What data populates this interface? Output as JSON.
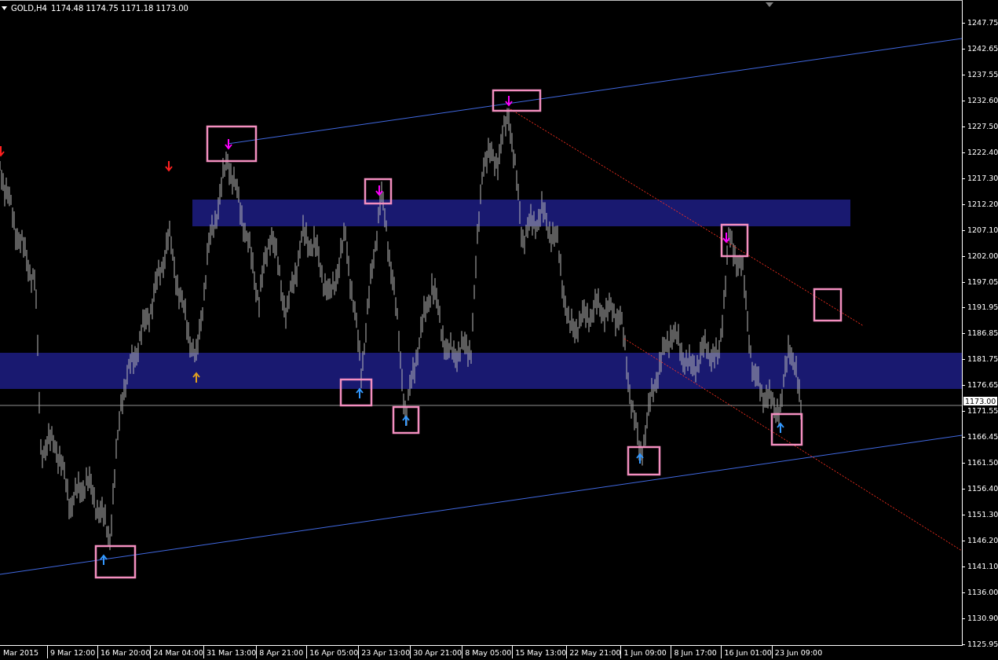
{
  "header": {
    "symbol": "GOLD,H4",
    "ohlc": "1174.48 1174.75 1171.18 1173.00"
  },
  "price_axis": {
    "labels": [
      "1247.75",
      "1242.65",
      "1237.55",
      "1232.60",
      "1227.50",
      "1222.40",
      "1217.30",
      "1212.20",
      "1207.10",
      "1202.00",
      "1197.05",
      "1191.95",
      "1186.85",
      "1181.75",
      "1176.65",
      "1171.55",
      "1166.45",
      "1161.50",
      "1156.40",
      "1151.30",
      "1146.20",
      "1141.10",
      "1136.00",
      "1130.90",
      "1125.95"
    ],
    "current_price": "1173.00"
  },
  "time_axis": {
    "labels": [
      "Mar 2015",
      "9 Mar 12:00",
      "16 Mar 20:00",
      "24 Mar 04:00",
      "31 Mar 13:00",
      "8 Apr 21:00",
      "16 Apr 05:00",
      "23 Apr 13:00",
      "30 Apr 21:00",
      "8 May 05:00",
      "15 May 13:00",
      "22 May 21:00",
      "1 Jun 09:00",
      "8 Jun 17:00",
      "16 Jun 01:00",
      "23 Jun 09:00"
    ]
  }
}
